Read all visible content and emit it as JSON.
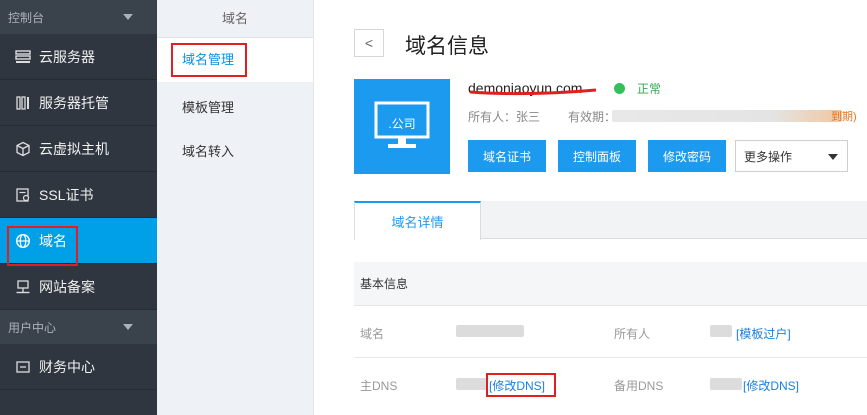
{
  "sidebar": {
    "group1": "控制台",
    "items": [
      {
        "label": "云服务器",
        "icon": "server-list-icon"
      },
      {
        "label": "服务器托管",
        "icon": "server-rack-icon"
      },
      {
        "label": "云虚拟主机",
        "icon": "cube-icon"
      },
      {
        "label": "SSL证书",
        "icon": "certificate-icon"
      },
      {
        "label": "域名",
        "icon": "globe-icon"
      },
      {
        "label": "网站备案",
        "icon": "filing-icon"
      }
    ],
    "group2": "用户中心",
    "items2": [
      {
        "label": "财务中心",
        "icon": "finance-icon"
      }
    ]
  },
  "subnav": {
    "title": "域名",
    "items": [
      "域名管理",
      "模板管理",
      "域名转入"
    ]
  },
  "main": {
    "back": "<",
    "title": "域名信息",
    "logo_text": ".公司",
    "domain_name": "demoniaoyun.com",
    "status": "正常",
    "owner": "所有人：张三",
    "expire_label": "有效期：",
    "expire_tail": "到期)",
    "buttons": [
      "域名证书",
      "控制面板",
      "修改密码"
    ],
    "more_select": "更多操作",
    "tab": "域名详情",
    "section": "基本信息",
    "row1": {
      "k1": "域名",
      "k2": "所有人",
      "link": "[模板过户]"
    },
    "row2": {
      "k1": "主DNS",
      "k2": "备用DNS",
      "link1": "[修改DNS]",
      "link2": "[修改DNS]"
    }
  },
  "colors": {
    "accent": "#1b9af0",
    "sidebar_bg": "#2f3640",
    "active": "#00a0e9",
    "highlight": "#e02020",
    "ok": "#33c05a"
  }
}
